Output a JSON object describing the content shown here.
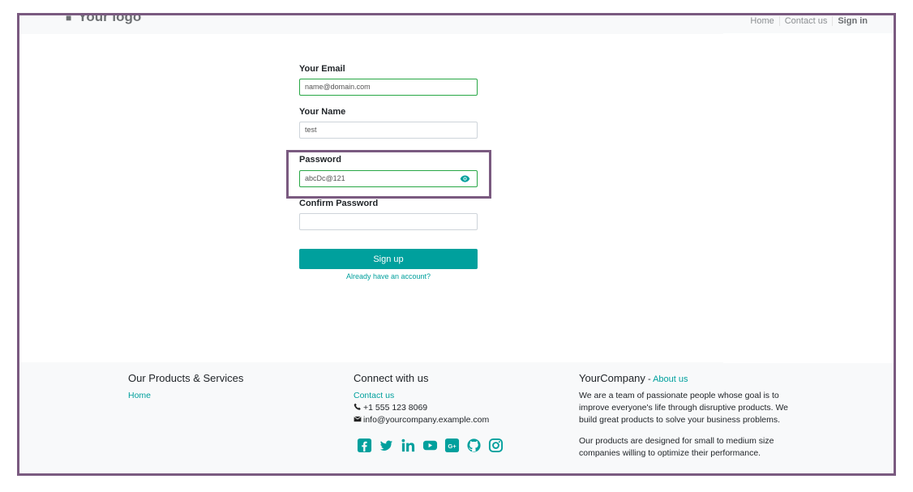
{
  "header": {
    "logo_text": "Your logo",
    "nav": [
      "Home",
      "Contact us",
      "Sign in"
    ]
  },
  "form": {
    "email_label": "Your Email",
    "email_value": "name@domain.com",
    "name_label": "Your Name",
    "name_value": "test",
    "password_label": "Password",
    "password_value": "abcDc@121",
    "confirm_label": "Confirm Password",
    "confirm_value": "",
    "signup_label": "Sign up",
    "have_account": "Already have an account?"
  },
  "footer": {
    "col1": {
      "title": "Our Products & Services",
      "home": "Home"
    },
    "col2": {
      "title": "Connect with us",
      "contact": "Contact us",
      "phone": "+1 555 123 8069",
      "email": "info@yourcompany.example.com",
      "social": [
        "facebook-icon",
        "twitter-icon",
        "linkedin-icon",
        "youtube-icon",
        "google-plus-icon",
        "github-icon",
        "instagram-icon"
      ]
    },
    "col3": {
      "title": "YourCompany",
      "title_sep": " - ",
      "about": "About us",
      "para1": "We are a team of passionate people whose goal is to improve everyone's life through disruptive products. We build great products to solve your business problems.",
      "para2": "Our products are designed for small to medium size companies willing to optimize their performance."
    }
  },
  "colors": {
    "accent": "#00a09d",
    "highlight": "#7a5a80",
    "valid": "#28a745"
  }
}
